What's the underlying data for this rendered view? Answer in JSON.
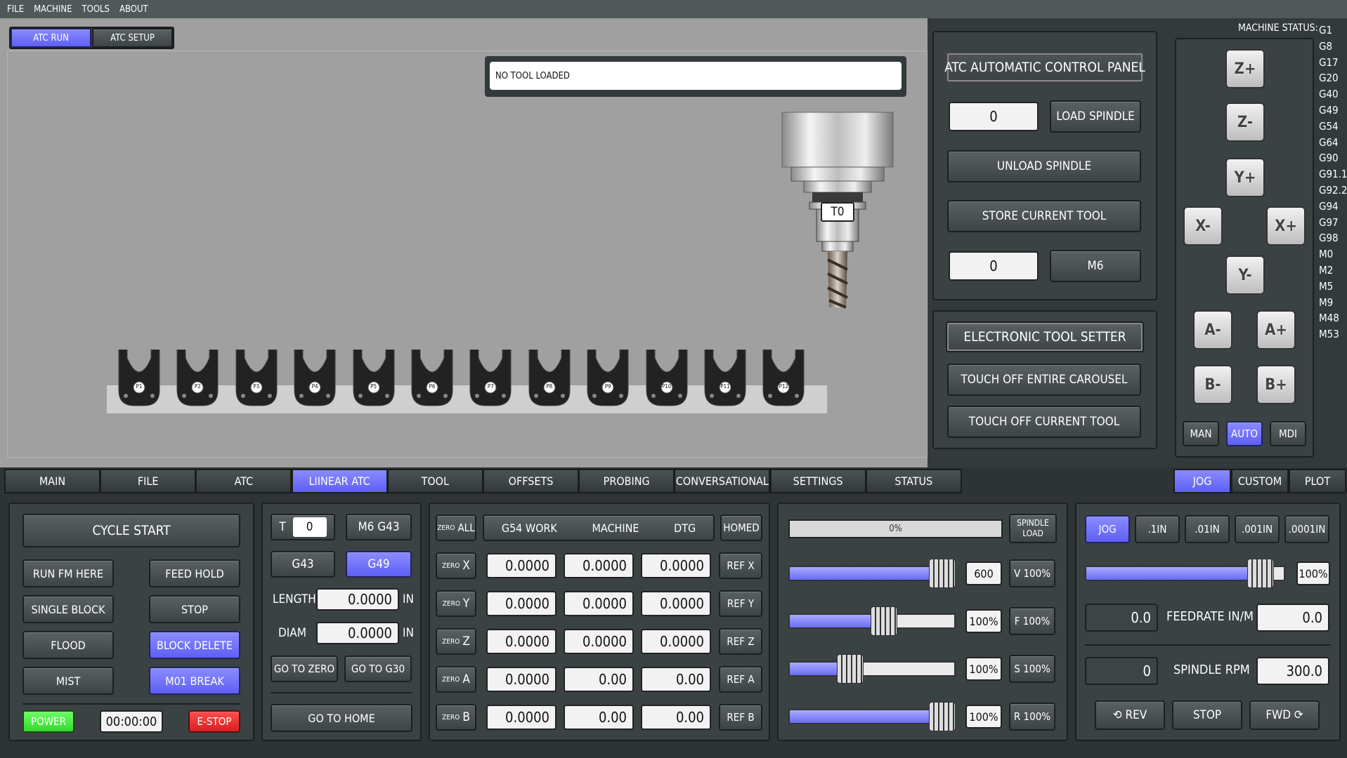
{
  "menu": [
    "FILE",
    "MACHINE",
    "TOOLS",
    "ABOUT"
  ],
  "atc_tabs": {
    "run": "ATC RUN",
    "setup": "ATC SETUP"
  },
  "tool_status": "NO TOOL LOADED",
  "spindle_tool_label": "T0",
  "pockets": [
    "P1",
    "P2",
    "P3",
    "P4",
    "P5",
    "P6",
    "P7",
    "P8",
    "P9",
    "P10",
    "P11",
    "P12"
  ],
  "atc_panel": {
    "title": "ATC AUTOMATIC CONTROL PANEL",
    "tool_input": "0",
    "load": "LOAD SPINDLE",
    "unload": "UNLOAD SPINDLE",
    "store": "STORE CURRENT TOOL",
    "m6_input": "0",
    "m6": "M6"
  },
  "tool_setter": {
    "title": "ELECTRONIC TOOL SETTER",
    "carousel": "TOUCH OFF ENTIRE CAROUSEL",
    "current": "TOUCH OFF CURRENT TOOL"
  },
  "machine_status": {
    "title": "MACHINE STATUS:",
    "codes": [
      "G1 G8",
      "G17",
      "G20",
      "G40",
      "G49",
      "G54",
      "G64",
      "G90",
      "G91.1",
      "G92.2",
      "G94",
      "G97",
      "G98",
      "M0",
      "M2",
      "M5",
      "M9",
      "M48",
      "M53"
    ]
  },
  "jog": {
    "zp": "Z+",
    "zm": "Z-",
    "yp": "Y+",
    "ym": "Y-",
    "xm": "X-",
    "xp": "X+",
    "am": "A-",
    "ap": "A+",
    "bm": "B-",
    "bp": "B+",
    "man": "MAN",
    "auto": "AUTO",
    "mdi": "MDI"
  },
  "tabs": [
    "MAIN",
    "FILE",
    "ATC",
    "LIINEAR ATC",
    "TOOL",
    "OFFSETS",
    "PROBING",
    "CONVERSATIONAL",
    "SETTINGS",
    "STATUS"
  ],
  "right_tabs": [
    "JOG",
    "CUSTOM",
    "PLOT"
  ],
  "control": {
    "cycle_start": "CYCLE START",
    "run_fm": "RUN FM HERE",
    "feed_hold": "FEED HOLD",
    "single_block": "SINGLE BLOCK",
    "stop": "STOP",
    "flood": "FLOOD",
    "block_delete": "BLOCK DELETE",
    "mist": "MIST",
    "m01": "M01 BREAK",
    "power": "POWER",
    "timer": "00:00:00",
    "estop": "E-STOP"
  },
  "toolpanel": {
    "t_label": "T",
    "t_value": "0",
    "m6g43": "M6 G43",
    "g43": "G43",
    "g49": "G49",
    "length_label": "LENGTH",
    "length": "0.0000",
    "in1": "IN",
    "diam_label": "DIAM",
    "diam": "0.0000",
    "in2": "IN",
    "goto_zero": "GO TO ZERO",
    "goto_g30": "GO TO G30",
    "goto_home": "GO TO HOME"
  },
  "dro": {
    "zero_all": "ZERO ALL",
    "zero": "ZERO",
    "headers": [
      "G54 WORK",
      "MACHINE",
      "DTG"
    ],
    "homed": "HOMED",
    "rows": [
      {
        "axis": "X",
        "work": "0.0000",
        "mach": "0.0000",
        "dtg": "0.0000",
        "ref": "REF X"
      },
      {
        "axis": "Y",
        "work": "0.0000",
        "mach": "0.0000",
        "dtg": "0.0000",
        "ref": "REF Y"
      },
      {
        "axis": "Z",
        "work": "0.0000",
        "mach": "0.0000",
        "dtg": "0.0000",
        "ref": "REF Z"
      },
      {
        "axis": "A",
        "work": "0.0000",
        "mach": "0.00",
        "dtg": "0.00",
        "ref": "REF A"
      },
      {
        "axis": "B",
        "work": "0.0000",
        "mach": "0.00",
        "dtg": "0.00",
        "ref": "REF B"
      }
    ]
  },
  "overrides": {
    "load_pct": "0%",
    "spindle_load": "SPINDLE LOAD",
    "rows": [
      {
        "val": "600",
        "btn": "V 100%",
        "level": 0.85
      },
      {
        "val": "100%",
        "btn": "F 100%",
        "level": 0.5
      },
      {
        "val": "100%",
        "btn": "S 100%",
        "level": 0.3
      },
      {
        "val": "100%",
        "btn": "R 100%",
        "level": 0.85
      }
    ]
  },
  "jogpanel": {
    "steps": [
      "JOG",
      ".1IN",
      ".01IN",
      ".001IN",
      ".0001IN"
    ],
    "jog_pct": "100%",
    "feed_cur": "0.0",
    "feed_label": "FEEDRATE IN/M",
    "feed_set": "0.0",
    "rpm_cur": "0",
    "rpm_label": "SPINDLE RPM",
    "rpm_set": "300.0",
    "rev": "⟲ REV",
    "stop": "STOP",
    "fwd": "FWD ⟳",
    "jog_level": 0.95
  }
}
